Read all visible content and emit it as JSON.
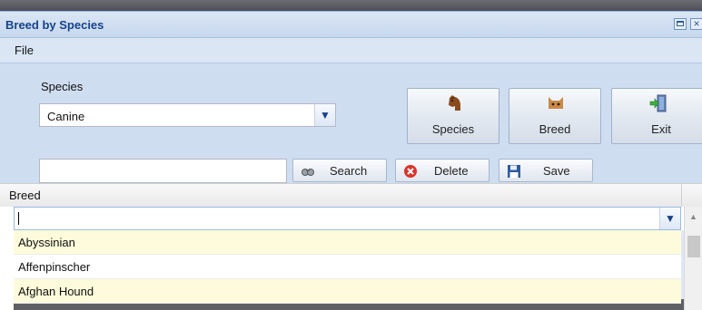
{
  "window": {
    "title": "Breed by Species"
  },
  "menu": {
    "file": "File"
  },
  "form": {
    "species_label": "Species",
    "species_value": "Canine",
    "search_value": ""
  },
  "toolbar": {
    "species": "Species",
    "breed": "Breed",
    "exit": "Exit",
    "search": "Search",
    "delete": "Delete",
    "save": "Save"
  },
  "grid": {
    "header": "Breed",
    "filter_value": "",
    "rows": [
      "Abyssinian",
      "Affenpinscher",
      "Afghan Hound"
    ]
  },
  "icons": {
    "species": "horse-head-icon",
    "breed": "cat-face-icon",
    "exit": "exit-door-icon",
    "search": "binoculars-icon",
    "delete": "red-x-circle-icon",
    "save": "floppy-disk-icon"
  },
  "colors": {
    "title_text": "#15428b",
    "panel_bg": "#cfddf0",
    "row_alt_bg": "#fdfbdb",
    "delete_red": "#d9342b"
  }
}
